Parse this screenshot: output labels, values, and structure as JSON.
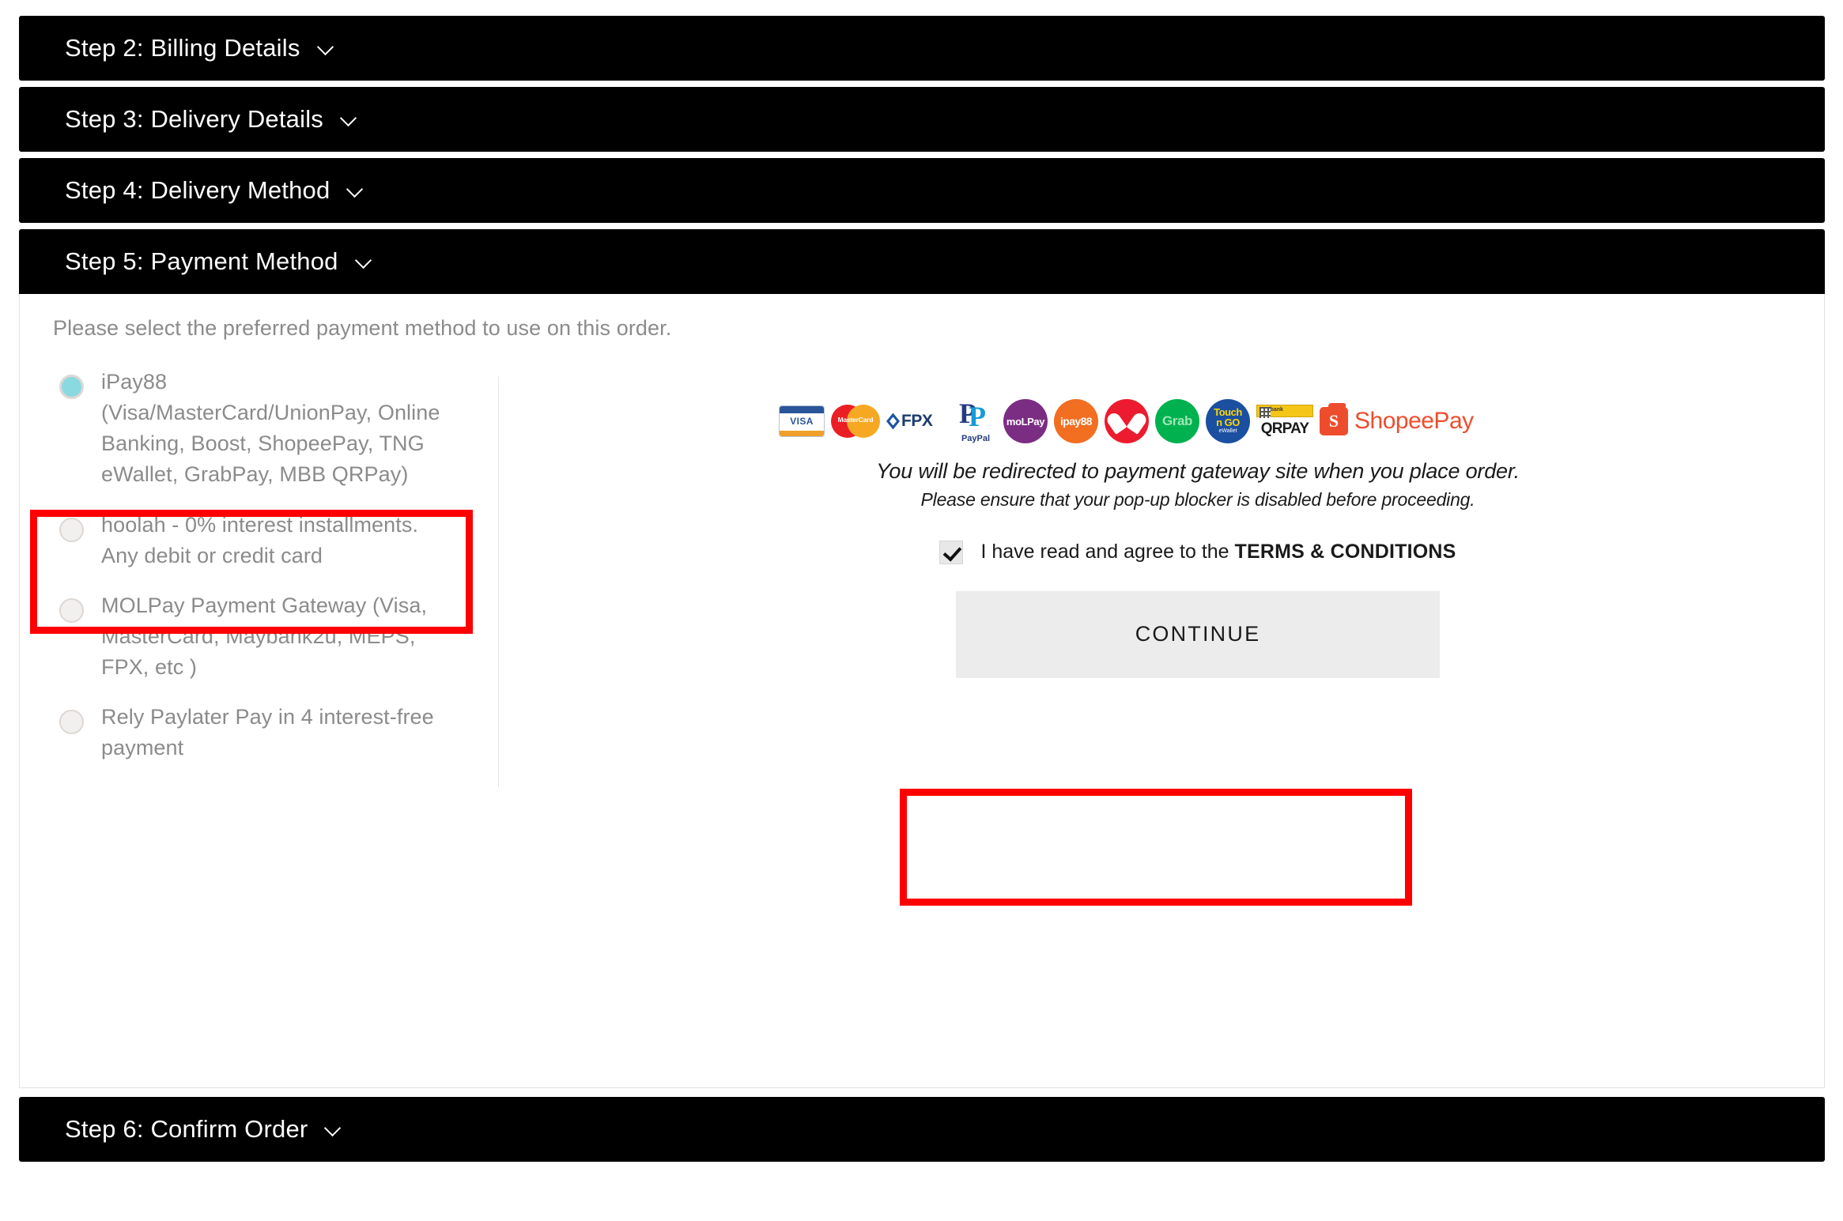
{
  "steps": [
    {
      "id": "step2",
      "title": "Step 2: Billing Details",
      "state": "collapsed"
    },
    {
      "id": "step3",
      "title": "Step 3: Delivery Details",
      "state": "collapsed"
    },
    {
      "id": "step4",
      "title": "Step 4: Delivery Method",
      "state": "collapsed"
    },
    {
      "id": "step5",
      "title": "Step 5: Payment Method",
      "state": "expanded"
    },
    {
      "id": "step6",
      "title": "Step 6: Confirm Order",
      "state": "collapsed"
    }
  ],
  "payment_panel": {
    "intro": "Please select the preferred payment method to use on this order.",
    "methods": [
      {
        "label": "iPay88 (Visa/MasterCard/UnionPay, Online Banking, Boost, ShopeePay, TNG eWallet, GrabPay, MBB QRPay)",
        "selected": true,
        "highlighted": true
      },
      {
        "label": "hoolah - 0% interest installments. Any debit or credit card",
        "selected": false,
        "highlighted": false
      },
      {
        "label": "MOLPay Payment Gateway (Visa, MasterCard, Maybank2u, MEPS, FPX, etc )",
        "selected": false,
        "highlighted": false
      },
      {
        "label": "Rely Paylater Pay in 4 interest-free payment",
        "selected": false,
        "highlighted": false
      }
    ],
    "gateway": {
      "logos": [
        "visa-logo",
        "mastercard-logo",
        "fpx-logo",
        "paypal-logo",
        "molpay-logo",
        "ipay88-logo",
        "boost-logo",
        "grab-logo",
        "touch-n-go-ewallet-logo",
        "maybank-qrpay-logo",
        "shopeepay-logo"
      ],
      "logo_text": {
        "visa": "VISA",
        "mastercard": "MasterCard",
        "fpx": "FPX",
        "paypal": "PayPal",
        "molpay": "moLPay",
        "ipay88": "ipay88",
        "grab": "Grab",
        "tng_1": "Touch",
        "tng_2": "n GO",
        "tng_3": "eWallet",
        "qrpay_bank": "Maybank",
        "qrpay": "QRPAY",
        "shopeepay_mark": "S",
        "shopeepay": "ShopeePay"
      },
      "redirect_notice_line1": "You will be redirected to payment gateway site when you place order.",
      "redirect_notice_line2": "Please ensure that your pop-up blocker is disabled before proceeding.",
      "terms_prefix": "I have read and agree to the ",
      "terms_link": "TERMS & CONDITIONS",
      "terms_checked": true,
      "continue_label": "CONTINUE"
    }
  },
  "annotations": {
    "highlight_color": "#ff0000",
    "boxes": [
      "ipay88-option-highlight",
      "continue-button-highlight"
    ]
  },
  "colors": {
    "header_bar": "#000000",
    "selected_radio": "#8ad9e0",
    "muted_text": "#8b8b8b",
    "button_bg": "#ececec",
    "shopee_orange": "#ee4d2d"
  }
}
